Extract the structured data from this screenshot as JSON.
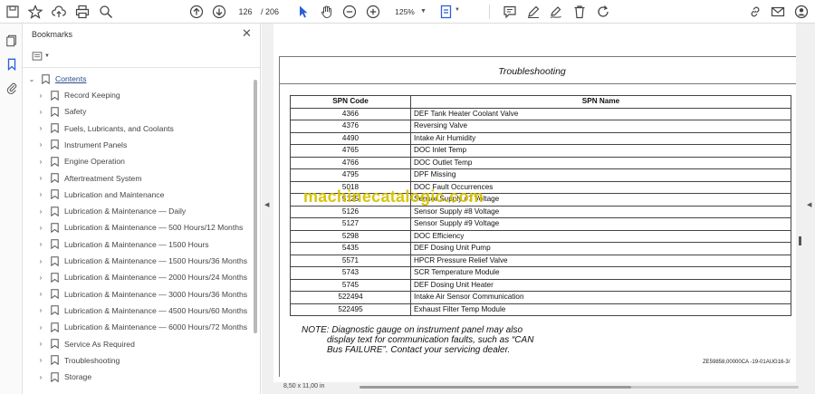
{
  "toolbar": {
    "page_current": "126",
    "page_total": "/ 206",
    "zoom": "125%"
  },
  "bookmarks": {
    "title": "Bookmarks",
    "close": "✕",
    "root": "Contents",
    "items": [
      {
        "label": "Record Keeping"
      },
      {
        "label": "Safety"
      },
      {
        "label": "Fuels, Lubricants, and Coolants"
      },
      {
        "label": "Instrument Panels"
      },
      {
        "label": "Engine Operation"
      },
      {
        "label": "Aftertreatment System"
      },
      {
        "label": "Lubrication and Maintenance"
      },
      {
        "label": "Lubrication & Maintenance — Daily"
      },
      {
        "label": "Lubrication & Maintenance — 500 Hours/12 Months"
      },
      {
        "label": "Lubrication & Maintenance — 1500 Hours"
      },
      {
        "label": "Lubrication & Maintenance — 1500 Hours/36 Months"
      },
      {
        "label": "Lubrication & Maintenance — 2000 Hours/24 Months"
      },
      {
        "label": "Lubrication & Maintenance — 3000 Hours/36 Months"
      },
      {
        "label": "Lubrication & Maintenance — 4500 Hours/60 Months"
      },
      {
        "label": "Lubrication & Maintenance — 6000 Hours/72 Months"
      },
      {
        "label": "Service As Required"
      },
      {
        "label": "Troubleshooting"
      },
      {
        "label": "Storage"
      }
    ]
  },
  "document": {
    "section_title": "Troubleshooting",
    "table": {
      "headers": [
        "SPN Code",
        "SPN Name"
      ],
      "rows": [
        [
          "4366",
          "DEF Tank Heater Coolant Valve"
        ],
        [
          "4376",
          "Reversing Valve"
        ],
        [
          "4490",
          "Intake Air Humidity"
        ],
        [
          "4765",
          "DOC Inlet Temp"
        ],
        [
          "4766",
          "DOC Outlet Temp"
        ],
        [
          "4795",
          "DPF Missing"
        ],
        [
          "5018",
          "DOC Fault Occurrences"
        ],
        [
          "5125",
          "Sensor Supply #7 Voltage"
        ],
        [
          "5126",
          "Sensor Supply #8 Voltage"
        ],
        [
          "5127",
          "Sensor Supply #9 Voltage"
        ],
        [
          "5298",
          "DOC Efficiency"
        ],
        [
          "5435",
          "DEF Dosing Unit Pump"
        ],
        [
          "5571",
          "HPCR Pressure Relief Valve"
        ],
        [
          "5743",
          "SCR Temperature Module"
        ],
        [
          "5745",
          "DEF Dosing Unit Heater"
        ],
        [
          "522494",
          "Intake Air Sensor Communication"
        ],
        [
          "522495",
          "Exhaust Filter Temp Module"
        ]
      ]
    },
    "note_line1": "NOTE: Diagnostic gauge on instrument panel may also",
    "note_line2": "display text for communication faults, such as “CAN",
    "note_line3": "Bus FAILURE”. Contact your servicing dealer.",
    "figure_ref": "ZE59858,00000CA -19-01AUG16-3/",
    "watermark": "machinecatalogic.com"
  },
  "status": {
    "page_size": "8,50 x 11,00 in"
  }
}
